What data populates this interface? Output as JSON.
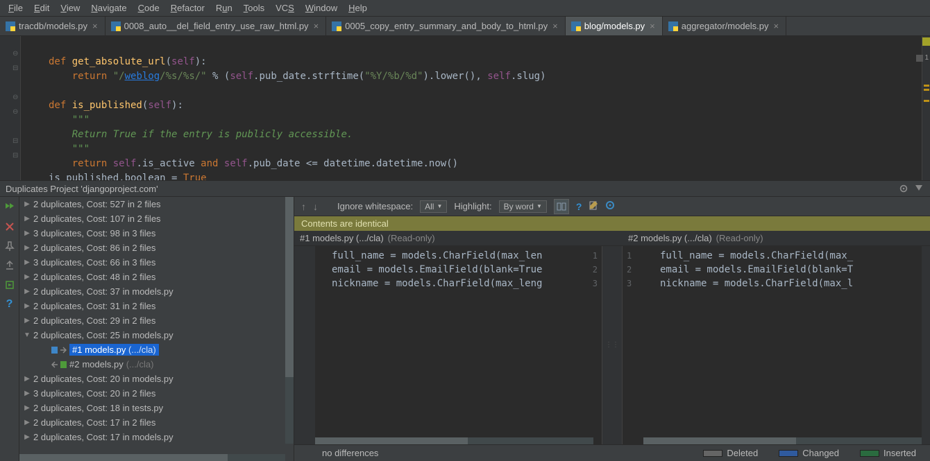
{
  "menu": [
    "File",
    "Edit",
    "View",
    "Navigate",
    "Code",
    "Refactor",
    "Run",
    "Tools",
    "VCS",
    "Window",
    "Help"
  ],
  "tabs": [
    {
      "label": "tracdb/models.py"
    },
    {
      "label": "0008_auto__del_field_entry_use_raw_html.py"
    },
    {
      "label": "0005_copy_entry_summary_and_body_to_html.py"
    },
    {
      "label": "blog/models.py"
    },
    {
      "label": "aggregator/models.py"
    }
  ],
  "code": {
    "l1a": "def ",
    "l1b": "get_absolute_url",
    "l1c": "(",
    "l1d": "self",
    "l1e": "):",
    "l2a": "return ",
    "l2b": "\"/",
    "l2c": "weblog",
    "l2d": "/%s/%s/\"",
    "l2e": " % (",
    "l2f": "self",
    "l2g": ".pub_date.strftime(",
    "l2h": "\"%Y/%b/%d\"",
    "l2i": ").lower(), ",
    "l2j": "self",
    "l2k": ".slug)",
    "l3a": "def ",
    "l3b": "is_published",
    "l3c": "(",
    "l3d": "self",
    "l3e": "):",
    "l4": "\"\"\"",
    "l5": "Return True if the entry is publicly accessible.",
    "l6": "\"\"\"",
    "l7a": "return ",
    "l7b": "self",
    "l7c": ".is_active ",
    "l7d": "and ",
    "l7e": "self",
    "l7f": ".pub_date <= datetime.datetime.now()",
    "l8a": "is_published.boolean = ",
    "l8b": "True"
  },
  "ws_badge": "1",
  "panel_title": "Duplicates Project 'djangoproject.com'",
  "tree": [
    {
      "t": "2 duplicates, Cost: 527 in 2 files",
      "a": "▶"
    },
    {
      "t": "2 duplicates, Cost: 107 in 2 files",
      "a": "▶"
    },
    {
      "t": "3 duplicates, Cost: 98 in 3 files",
      "a": "▶"
    },
    {
      "t": "2 duplicates, Cost: 86 in 2 files",
      "a": "▶"
    },
    {
      "t": "3 duplicates, Cost: 66 in 3 files",
      "a": "▶"
    },
    {
      "t": "2 duplicates, Cost: 48 in 2 files",
      "a": "▶"
    },
    {
      "t": "2 duplicates, Cost: 37 in models.py",
      "a": "▶"
    },
    {
      "t": "2 duplicates, Cost: 31 in 2 files",
      "a": "▶"
    },
    {
      "t": "2 duplicates, Cost: 29 in 2 files",
      "a": "▶"
    },
    {
      "t": "2 duplicates, Cost: 25 in models.py",
      "a": "▼"
    },
    {
      "t": "2 duplicates, Cost: 20 in models.py",
      "a": "▶"
    },
    {
      "t": "3 duplicates, Cost: 20 in 2 files",
      "a": "▶"
    },
    {
      "t": "2 duplicates, Cost: 18 in tests.py",
      "a": "▶"
    },
    {
      "t": "2 duplicates, Cost: 17 in 2 files",
      "a": "▶"
    },
    {
      "t": "2 duplicates, Cost: 17 in models.py",
      "a": "▶"
    }
  ],
  "tree_child1_a": "#1 ",
  "tree_child1_b": "models.py ",
  "tree_child1_c": "(.../cla)",
  "tree_child2_a": "#2 ",
  "tree_child2_b": "models.py ",
  "tree_child2_c": "(.../cla)",
  "diff_toolbar": {
    "ignore_ws": "Ignore whitespace:",
    "ignore_val": "All",
    "highlight": "Highlight:",
    "highlight_val": "By word"
  },
  "identical": "Contents are identical",
  "head1": "#1 models.py (.../cla)",
  "head1_ro": "(Read-only)",
  "head2": "#2 models.py (.../cla)",
  "head2_ro": "(Read-only)",
  "diff_lines": {
    "a": "full_name = models.CharField(max_len",
    "b": "email = models.EmailField(blank=True",
    "c": "nickname = models.CharField(max_leng",
    "a2": "full_name = models.CharField(max_",
    "b2": "email = models.EmailField(blank=T",
    "c2": "nickname = models.CharField(max_l"
  },
  "ln": {
    "n1": "1",
    "n2": "2",
    "n3": "3"
  },
  "legend": {
    "nodiff": "no differences",
    "del": "Deleted",
    "chg": "Changed",
    "ins": "Inserted"
  }
}
